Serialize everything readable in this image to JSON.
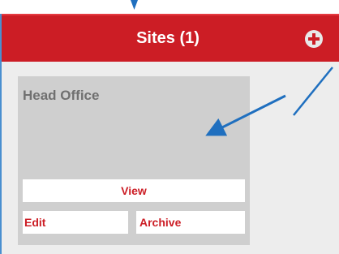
{
  "header": {
    "title": "Sites (1)",
    "add_icon": "plus-circle-icon",
    "background_color": "#cc1d25"
  },
  "site_card": {
    "name": "Head Office",
    "view_label": "View",
    "edit_label": "Edit",
    "archive_label": "Archive",
    "accent_color": "#cc1d25"
  },
  "annotations": {
    "arrow_color": "#1f6fbf",
    "arrows": [
      "down-arrow-icon",
      "pointer-arrow-icon",
      "pointer-arrow-icon"
    ]
  }
}
